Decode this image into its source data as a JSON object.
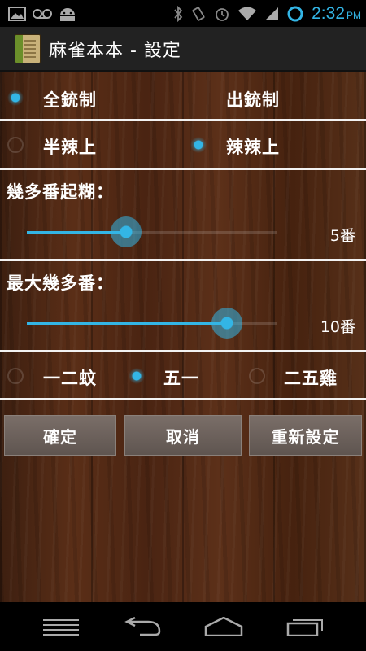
{
  "status_bar": {
    "time": "2:32",
    "ampm": "PM",
    "icons": [
      "image-icon",
      "voicemail-icon",
      "android-icon",
      "bluetooth-icon",
      "vibrate-icon",
      "alarm-icon",
      "wifi-icon",
      "signal-icon",
      "battery-icon"
    ]
  },
  "action_bar": {
    "title": "麻雀本本 - 設定"
  },
  "mode": {
    "options": [
      "全銃制",
      "出銃制"
    ],
    "selected": 0
  },
  "spicy": {
    "options": [
      "半辣上",
      "辣辣上"
    ],
    "selected": 1
  },
  "min_fan": {
    "title": "幾多番起糊：",
    "value": "5番",
    "level": 0.4
  },
  "max_fan": {
    "title": "最大幾多番：",
    "value": "10番",
    "level": 0.8
  },
  "payout": {
    "options": [
      "一二蚊",
      "五一",
      "二五雞"
    ],
    "selected": 1
  },
  "buttons": {
    "ok": "確定",
    "cancel": "取消",
    "reset": "重新設定"
  },
  "colors": {
    "accent": "#33b5e5",
    "divider": "#f2f2f2",
    "button": "#6b615c"
  }
}
